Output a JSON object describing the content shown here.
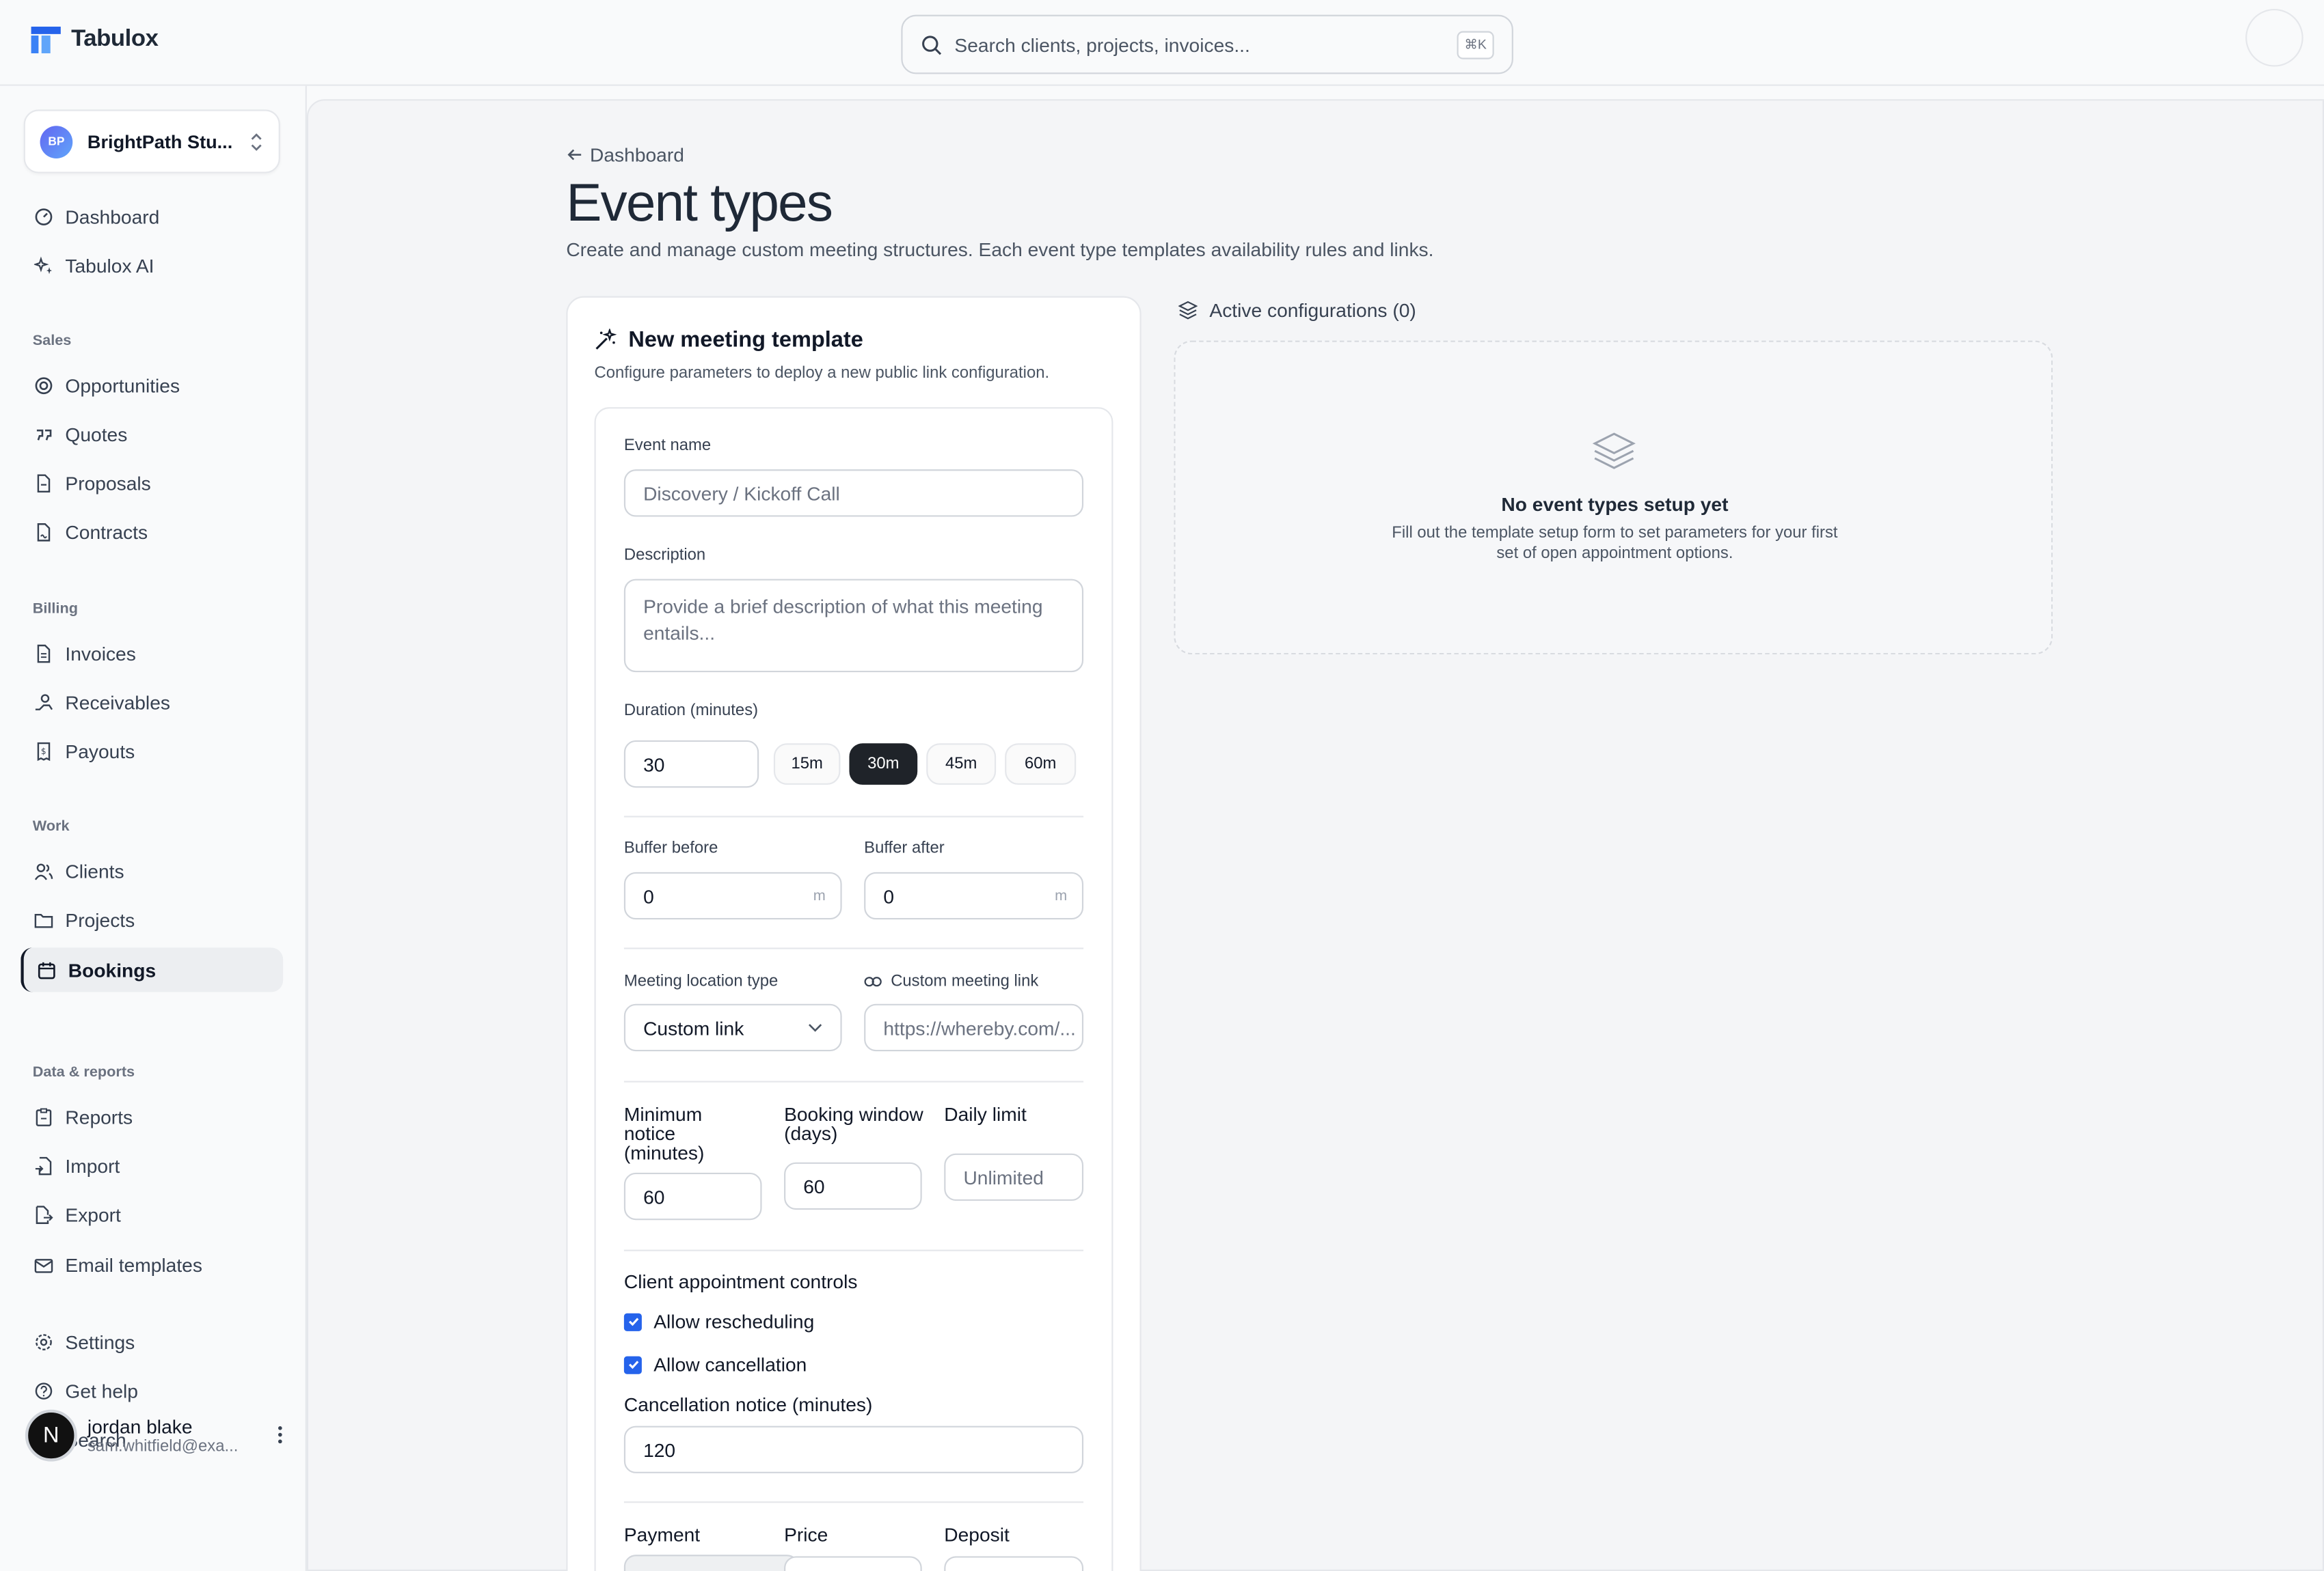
{
  "app": {
    "name": "Tabulox"
  },
  "search": {
    "placeholder": "Search clients, projects, invoices...",
    "shortcut": "⌘K"
  },
  "workspace": {
    "initials": "BP",
    "name": "BrightPath Stu..."
  },
  "sidebar": {
    "top": [
      {
        "label": "Dashboard",
        "icon": "gauge-icon"
      },
      {
        "label": "Tabulox AI",
        "icon": "sparkles-icon"
      }
    ],
    "sections": [
      {
        "title": "Sales",
        "items": [
          {
            "label": "Opportunities",
            "icon": "target-icon"
          },
          {
            "label": "Quotes",
            "icon": "quote-icon"
          },
          {
            "label": "Proposals",
            "icon": "file-icon"
          },
          {
            "label": "Contracts",
            "icon": "file-signature-icon"
          }
        ]
      },
      {
        "title": "Billing",
        "items": [
          {
            "label": "Invoices",
            "icon": "file-text-icon"
          },
          {
            "label": "Receivables",
            "icon": "hand-coins-icon"
          },
          {
            "label": "Payouts",
            "icon": "receipt-icon"
          }
        ]
      },
      {
        "title": "Work",
        "items": [
          {
            "label": "Clients",
            "icon": "users-icon"
          },
          {
            "label": "Projects",
            "icon": "folder-icon"
          },
          {
            "label": "Bookings",
            "icon": "calendar-icon"
          }
        ]
      },
      {
        "title": "Data & reports",
        "items": [
          {
            "label": "Reports",
            "icon": "clipboard-icon"
          },
          {
            "label": "Import",
            "icon": "file-import-icon"
          },
          {
            "label": "Export",
            "icon": "file-export-icon"
          },
          {
            "label": "Email templates",
            "icon": "mail-icon"
          }
        ]
      }
    ],
    "bottom": [
      {
        "label": "Settings",
        "icon": "gear-icon"
      },
      {
        "label": "Get help",
        "icon": "help-circle-icon"
      },
      {
        "label": "Search",
        "icon": "search-icon"
      }
    ],
    "active": "Bookings"
  },
  "user": {
    "initial": "N",
    "name": "jordan blake",
    "email": "sam.whitfield@exa..."
  },
  "page": {
    "back_label": "Dashboard",
    "title": "Event types",
    "subtitle": "Create and manage custom meeting structures. Each event type templates availability rules and links."
  },
  "form": {
    "title": "New meeting template",
    "subtitle": "Configure parameters to deploy a new public link configuration.",
    "event_name_label": "Event name",
    "event_name_placeholder": "Discovery / Kickoff Call",
    "description_label": "Description",
    "description_placeholder": "Provide a brief description of what this meeting entails...",
    "duration_label": "Duration (minutes)",
    "duration_value": "30",
    "duration_presets": [
      "15m",
      "30m",
      "45m",
      "60m"
    ],
    "duration_selected": "30m",
    "buffer_before_label": "Buffer before",
    "buffer_before_value": "0",
    "buffer_after_label": "Buffer after",
    "buffer_after_value": "0",
    "buffer_unit": "m",
    "location_type_label": "Meeting location type",
    "location_type_value": "Custom link",
    "custom_link_label": "Custom meeting link",
    "custom_link_placeholder": "https://whereby.com/...",
    "min_notice_label": "Minimum notice (minutes)",
    "min_notice_value": "60",
    "booking_window_label": "Booking window (days)",
    "booking_window_value": "60",
    "daily_limit_label": "Daily limit",
    "daily_limit_placeholder": "Unlimited",
    "client_controls_label": "Client appointment controls",
    "allow_rescheduling_label": "Allow rescheduling",
    "allow_rescheduling_checked": true,
    "allow_cancellation_label": "Allow cancellation",
    "allow_cancellation_checked": true,
    "cancellation_notice_label": "Cancellation notice (minutes)",
    "cancellation_notice_value": "120",
    "payment_label": "Payment",
    "price_label": "Price",
    "deposit_label": "Deposit"
  },
  "active_configs": {
    "title": "Active configurations (0)",
    "empty_title": "No event types setup yet",
    "empty_text": "Fill out the template setup form to set parameters for your first set of open appointment options."
  },
  "colors": {
    "accent": "#2563eb",
    "chip_selected": "#1f2329"
  }
}
